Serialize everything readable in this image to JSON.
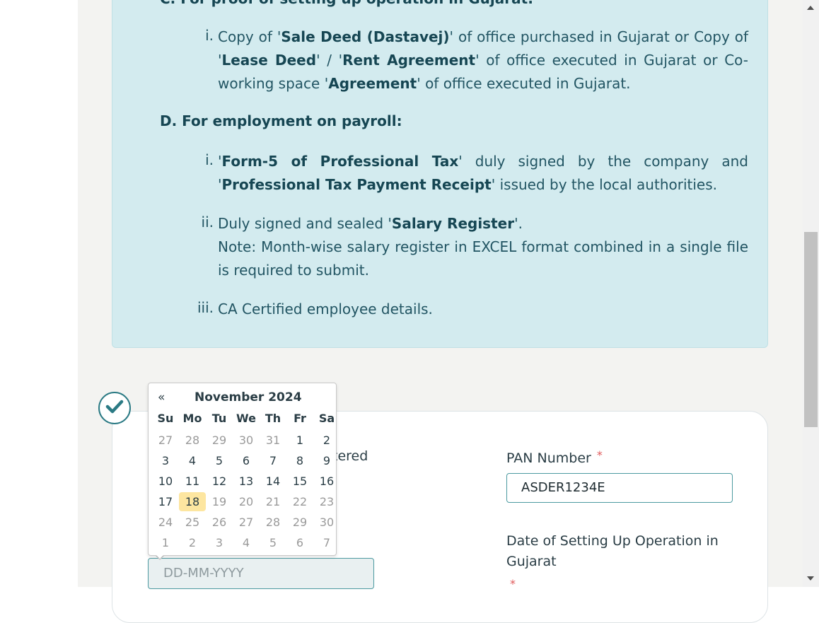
{
  "info": {
    "c_heading": "C. For proof of setting up operation in Gujarat:",
    "c_items": [
      {
        "num": "i.",
        "parts": [
          "Copy of '",
          "Sale Deed (Dastavej)",
          "' of office purchased in Gujarat or Copy of '",
          "Lease Deed",
          "' / '",
          "Rent Agreement",
          "' of office executed in Gujarat or Co-working space '",
          "Agreement",
          "' of office executed in Gujarat."
        ]
      }
    ],
    "d_heading": "D. For employment on payroll:",
    "d_items": [
      {
        "num": "i.",
        "parts": [
          "'",
          "Form-5 of Professional Tax",
          "' duly signed by the company and '",
          "Professional Tax Payment Receipt",
          "' issued by the local authorities."
        ]
      },
      {
        "num": "ii.",
        "parts": [
          "Duly signed and sealed '",
          "Salary Register",
          "'."
        ],
        "note": "Note: Month-wise salary register in EXCEL format combined in a single file is required to submit."
      },
      {
        "num": "iii.",
        "parts": [
          "CA Certified employee details."
        ]
      }
    ]
  },
  "form": {
    "partial_label": "tered",
    "pan_label": "PAN Number",
    "pan_required": "*",
    "pan_value": "ASDER1234E",
    "date_label_line1": "Date of Setting Up Operation in",
    "date_label_line2": "Gujarat",
    "date_required": "*",
    "date_placeholder": "DD-MM-YYYY"
  },
  "calendar": {
    "prev": "«",
    "title": "November 2024",
    "weekdays": [
      "Su",
      "Mo",
      "Tu",
      "We",
      "Th",
      "Fr",
      "Sa"
    ],
    "weeks": [
      [
        "27",
        "28",
        "29",
        "30",
        "31",
        "1",
        "2"
      ],
      [
        "3",
        "4",
        "5",
        "6",
        "7",
        "8",
        "9"
      ],
      [
        "10",
        "11",
        "12",
        "13",
        "14",
        "15",
        "16"
      ],
      [
        "17",
        "18",
        "19",
        "20",
        "21",
        "22",
        "23"
      ],
      [
        "24",
        "25",
        "26",
        "27",
        "28",
        "29",
        "30"
      ],
      [
        "1",
        "2",
        "3",
        "4",
        "5",
        "6",
        "7"
      ]
    ],
    "today": "18",
    "colors": {
      "today_bg": "#fde6a0",
      "accent": "#2b7a84"
    }
  }
}
